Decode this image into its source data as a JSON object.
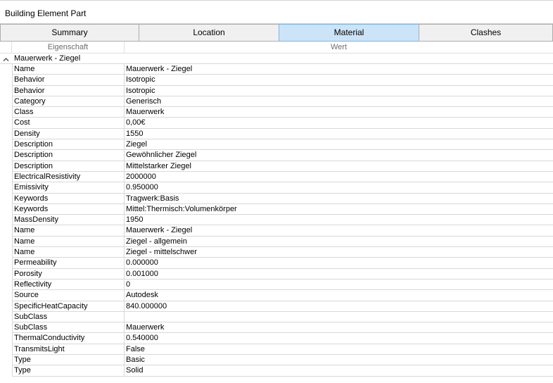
{
  "panel": {
    "title": "Building Element Part"
  },
  "tabs": [
    {
      "label": "Summary",
      "active": false
    },
    {
      "label": "Location",
      "active": false
    },
    {
      "label": "Material",
      "active": true
    },
    {
      "label": "Clashes",
      "active": false
    }
  ],
  "grid": {
    "headers": {
      "property": "Eigenschaft",
      "value": "Wert"
    },
    "group": {
      "label": "Mauerwerk - Ziegel",
      "expanded": true
    },
    "rows": [
      {
        "property": "Name",
        "value": "Mauerwerk - Ziegel"
      },
      {
        "property": "Behavior",
        "value": "Isotropic"
      },
      {
        "property": "Behavior",
        "value": "Isotropic"
      },
      {
        "property": "Category",
        "value": "Generisch"
      },
      {
        "property": "Class",
        "value": "Mauerwerk"
      },
      {
        "property": "Cost",
        "value": "0,00€"
      },
      {
        "property": "Density",
        "value": "1550"
      },
      {
        "property": "Description",
        "value": "Ziegel"
      },
      {
        "property": "Description",
        "value": "Gewöhnlicher Ziegel"
      },
      {
        "property": "Description",
        "value": "Mittelstarker Ziegel"
      },
      {
        "property": "ElectricalResistivity",
        "value": "2000000"
      },
      {
        "property": "Emissivity",
        "value": "0.950000"
      },
      {
        "property": "Keywords",
        "value": "Tragwerk:Basis"
      },
      {
        "property": "Keywords",
        "value": "Mittel:Thermisch:Volumenkörper"
      },
      {
        "property": "MassDensity",
        "value": "1950"
      },
      {
        "property": "Name",
        "value": "Mauerwerk - Ziegel"
      },
      {
        "property": "Name",
        "value": "Ziegel - allgemein"
      },
      {
        "property": "Name",
        "value": "Ziegel - mittelschwer"
      },
      {
        "property": "Permeability",
        "value": "0.000000"
      },
      {
        "property": "Porosity",
        "value": "0.001000"
      },
      {
        "property": "Reflectivity",
        "value": "0"
      },
      {
        "property": "Source",
        "value": "Autodesk"
      },
      {
        "property": "SpecificHeatCapacity",
        "value": "840.000000"
      },
      {
        "property": "SubClass",
        "value": ""
      },
      {
        "property": "SubClass",
        "value": "Mauerwerk"
      },
      {
        "property": "ThermalConductivity",
        "value": "0.540000"
      },
      {
        "property": "TransmitsLight",
        "value": "False"
      },
      {
        "property": "Type",
        "value": "Basic"
      },
      {
        "property": "Type",
        "value": "Solid"
      }
    ]
  },
  "icons": {
    "group_toggle": "chevron-up-icon"
  },
  "colors": {
    "active_tab_bg": "#cce4f7",
    "active_tab_border": "#7eb4ea",
    "tab_bg": "#f0f0f0",
    "grid_line": "#d8d8d8"
  }
}
